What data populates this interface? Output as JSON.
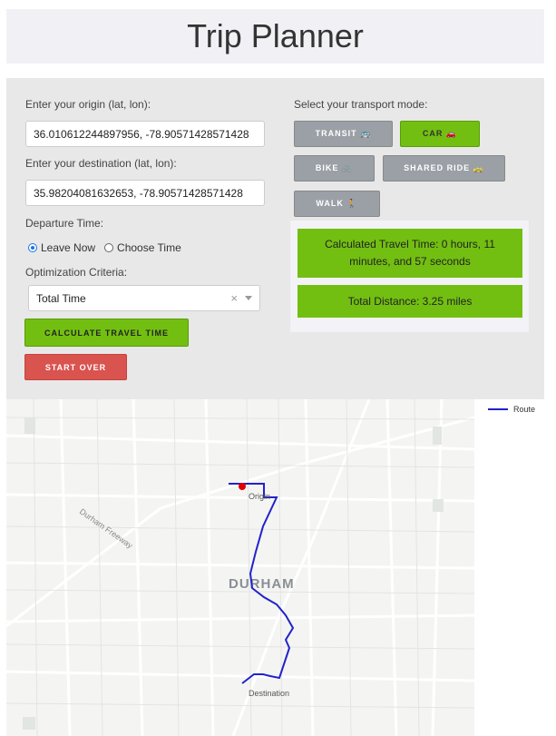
{
  "header": {
    "title": "Trip Planner"
  },
  "form": {
    "origin_label": "Enter your origin (lat, lon):",
    "origin_value": "36.010612244897956, -78.90571428571428",
    "destination_label": "Enter your destination (lat, lon):",
    "destination_value": "35.98204081632653, -78.90571428571428",
    "departure_label": "Departure Time:",
    "departure_options": [
      "Leave Now",
      "Choose Time"
    ],
    "departure_selected": "Leave Now",
    "criteria_label": "Optimization Criteria:",
    "criteria_value": "Total Time",
    "calculate_label": "CALCULATE TRAVEL TIME",
    "start_over_label": "START OVER"
  },
  "modes": {
    "label": "Select your transport mode:",
    "transit": "TRANSIT 🚌",
    "car": "CAR 🚗",
    "bike": "BIKE 🚲",
    "shared_ride": "SHARED RIDE 🚕",
    "walk": "WALK 🚶",
    "selected": "car"
  },
  "results": {
    "travel_time": "Calculated Travel Time: 0 hours, 11 minutes, and 57 seconds",
    "distance": "Total Distance: 3.25 miles"
  },
  "map": {
    "city_label": "DURHAM",
    "origin_label": "Origin",
    "destination_label": "Destination",
    "road_label": "Durham Freeway",
    "legend_label": "Route",
    "route_color": "#2222cc",
    "origin_marker_color": "#e00000"
  }
}
